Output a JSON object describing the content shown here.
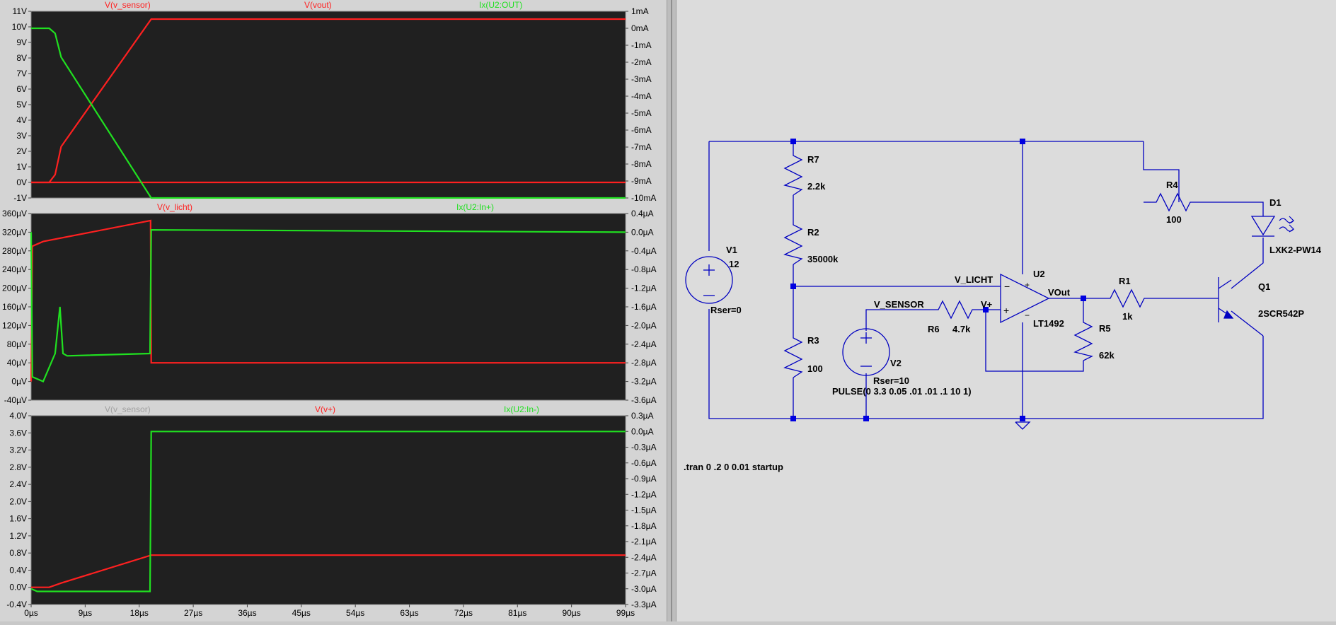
{
  "colors": {
    "plot_bg": "#202020",
    "grid": "#585858",
    "red_trace": "#ff2020",
    "green_trace": "#20e020",
    "gray_label": "#a0a0a0",
    "wire": "#0000c0",
    "junction": "#0000e0"
  },
  "x_axis": {
    "unit": "µs",
    "ticks": [
      "0µs",
      "9µs",
      "18µs",
      "27µs",
      "36µs",
      "45µs",
      "54µs",
      "63µs",
      "72µs",
      "81µs",
      "90µs",
      "99µs"
    ]
  },
  "panes": [
    {
      "labels": [
        {
          "text": "V(v_sensor)",
          "color": "red"
        },
        {
          "text": "V(vout)",
          "color": "red"
        },
        {
          "text": "Ix(U2:OUT)",
          "color": "green"
        }
      ],
      "left_ticks": [
        "11V",
        "10V",
        "9V",
        "8V",
        "7V",
        "6V",
        "5V",
        "4V",
        "3V",
        "2V",
        "1V",
        "0V",
        "-1V"
      ],
      "right_ticks": [
        "1mA",
        "0mA",
        "-1mA",
        "-2mA",
        "-3mA",
        "-4mA",
        "-5mA",
        "-6mA",
        "-7mA",
        "-8mA",
        "-9mA",
        "-10mA"
      ]
    },
    {
      "labels": [
        {
          "text": "V(v_licht)",
          "color": "red"
        },
        {
          "text": "Ix(U2:In+)",
          "color": "green"
        }
      ],
      "left_ticks": [
        "360µV",
        "320µV",
        "280µV",
        "240µV",
        "200µV",
        "160µV",
        "120µV",
        "80µV",
        "40µV",
        "0µV",
        "-40µV"
      ],
      "right_ticks": [
        "0.4µA",
        "0.0µA",
        "-0.4µA",
        "-0.8µA",
        "-1.2µA",
        "-1.6µA",
        "-2.0µA",
        "-2.4µA",
        "-2.8µA",
        "-3.2µA",
        "-3.6µA"
      ]
    },
    {
      "labels": [
        {
          "text": "V(v_sensor)",
          "color": "gray"
        },
        {
          "text": "V(v+)",
          "color": "red"
        },
        {
          "text": "Ix(U2:In-)",
          "color": "green"
        }
      ],
      "left_ticks": [
        "4.0V",
        "3.6V",
        "3.2V",
        "2.8V",
        "2.4V",
        "2.0V",
        "1.6V",
        "1.2V",
        "0.8V",
        "0.4V",
        "0.0V",
        "-0.4V"
      ],
      "right_ticks": [
        "0.3µA",
        "0.0µA",
        "-0.3µA",
        "-0.6µA",
        "-0.9µA",
        "-1.2µA",
        "-1.5µA",
        "-1.8µA",
        "-2.1µA",
        "-2.4µA",
        "-2.7µA",
        "-3.0µA",
        "-3.3µA"
      ]
    }
  ],
  "chart_data": [
    {
      "type": "line",
      "x_unit": "µs",
      "xlim": [
        0,
        99
      ],
      "ylim_left": [
        -1,
        11
      ],
      "ylim_right": [
        -10,
        1
      ],
      "series": [
        {
          "name": "V(v_sensor)",
          "axis": "left",
          "color": "red",
          "x": [
            0,
            99
          ],
          "y": [
            0,
            0
          ]
        },
        {
          "name": "V(vout)",
          "axis": "left",
          "color": "red",
          "x": [
            0,
            3,
            4,
            5,
            20,
            99
          ],
          "y": [
            0,
            0,
            0.5,
            2.3,
            10.5,
            10.5
          ]
        },
        {
          "name": "Ix(U2:OUT)",
          "axis": "right",
          "color": "green",
          "x": [
            0,
            3,
            4,
            5,
            20,
            99
          ],
          "y": [
            0,
            0,
            -0.3,
            -1.7,
            -10,
            -10
          ]
        }
      ]
    },
    {
      "type": "line",
      "x_unit": "µs",
      "xlim": [
        0,
        99
      ],
      "ylim_left": [
        -40,
        360
      ],
      "ylim_right": [
        -3.6,
        0.4
      ],
      "series": [
        {
          "name": "V(v_licht)",
          "axis": "left",
          "color": "red",
          "x": [
            0,
            0.2,
            2,
            19.9,
            20,
            99
          ],
          "y": [
            0,
            290,
            300,
            345,
            40,
            40
          ]
        },
        {
          "name": "Ix(U2:In+)",
          "axis": "right",
          "color": "green",
          "x": [
            0,
            0.2,
            2,
            4,
            4.8,
            5.3,
            6,
            19.8,
            20,
            99
          ],
          "y": [
            0,
            -3.1,
            -3.2,
            -2.6,
            -1.6,
            -2.6,
            -2.65,
            -2.6,
            0.05,
            0
          ]
        }
      ]
    },
    {
      "type": "line",
      "x_unit": "µs",
      "xlim": [
        0,
        99
      ],
      "ylim_left": [
        -0.4,
        4.0
      ],
      "ylim_right": [
        -3.3,
        0.3
      ],
      "series": [
        {
          "name": "V(v+)",
          "axis": "left",
          "color": "red",
          "x": [
            0,
            3,
            5,
            20,
            99
          ],
          "y": [
            0,
            0,
            0.1,
            0.75,
            0.75
          ]
        },
        {
          "name": "Ix(U2:In-)",
          "axis": "right",
          "color": "green",
          "x": [
            0,
            1,
            19.8,
            20,
            99
          ],
          "y": [
            -3.0,
            -3.05,
            -3.05,
            0.0,
            0.0
          ]
        }
      ]
    }
  ],
  "schematic": {
    "components": {
      "V1": {
        "name": "V1",
        "value": "12",
        "extra": "Rser=0"
      },
      "V2": {
        "name": "V2",
        "value": "Rser=10",
        "extra": "PULSE(0 3.3 0.05 .01 .01 .1 10 1)"
      },
      "R7": {
        "name": "R7",
        "value": "2.2k"
      },
      "R2": {
        "name": "R2",
        "value": "35000k"
      },
      "R3": {
        "name": "R3",
        "value": "100"
      },
      "R6": {
        "name": "R6",
        "value": "4.7k"
      },
      "R1": {
        "name": "R1",
        "value": "1k"
      },
      "R5": {
        "name": "R5",
        "value": "62k"
      },
      "R4": {
        "name": "R4",
        "value": "100"
      },
      "U2": {
        "name": "U2",
        "value": "LT1492"
      },
      "D1": {
        "name": "D1",
        "value": "LXK2-PW14"
      },
      "Q1": {
        "name": "Q1",
        "value": "2SCR542P"
      }
    },
    "nets": {
      "v_licht": "V_LICHT",
      "v_sensor": "V_SENSOR",
      "vout": "VOut",
      "vplus": "V+"
    },
    "directive": ".tran 0 .2 0 0.01 startup"
  }
}
